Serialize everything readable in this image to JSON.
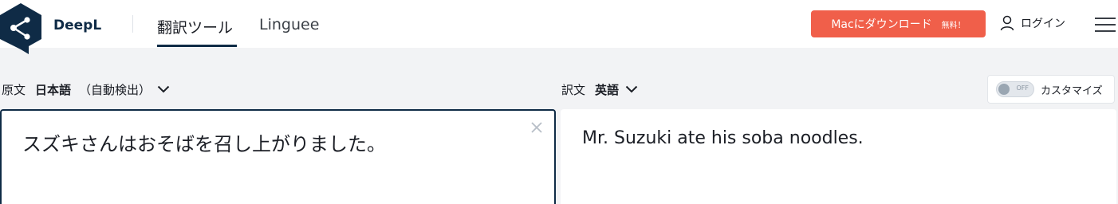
{
  "header": {
    "brand": "DeepL",
    "nav_tabs": [
      {
        "label": "翻訳ツール",
        "active": true
      },
      {
        "label": "Linguee",
        "active": false
      }
    ],
    "download_button": {
      "label": "Macにダウンロード",
      "badge": "無料！"
    },
    "login_label": "ログイン",
    "accent_color": "#f05f4a",
    "brand_color": "#0f2b46"
  },
  "source": {
    "label": "原文",
    "language": "日本語",
    "detect_note": "（自動検出）",
    "text": "スズキさんはおそばを召し上がりました。"
  },
  "target": {
    "label": "訳文",
    "language": "英語",
    "text": "Mr. Suzuki ate his soba noodles."
  },
  "customize": {
    "toggle_state": "OFF",
    "label": "カスタマイズ"
  },
  "icons": [
    "deepl-logo-icon",
    "user-icon",
    "hamburger-menu-icon",
    "chevron-down-icon",
    "close-icon"
  ]
}
